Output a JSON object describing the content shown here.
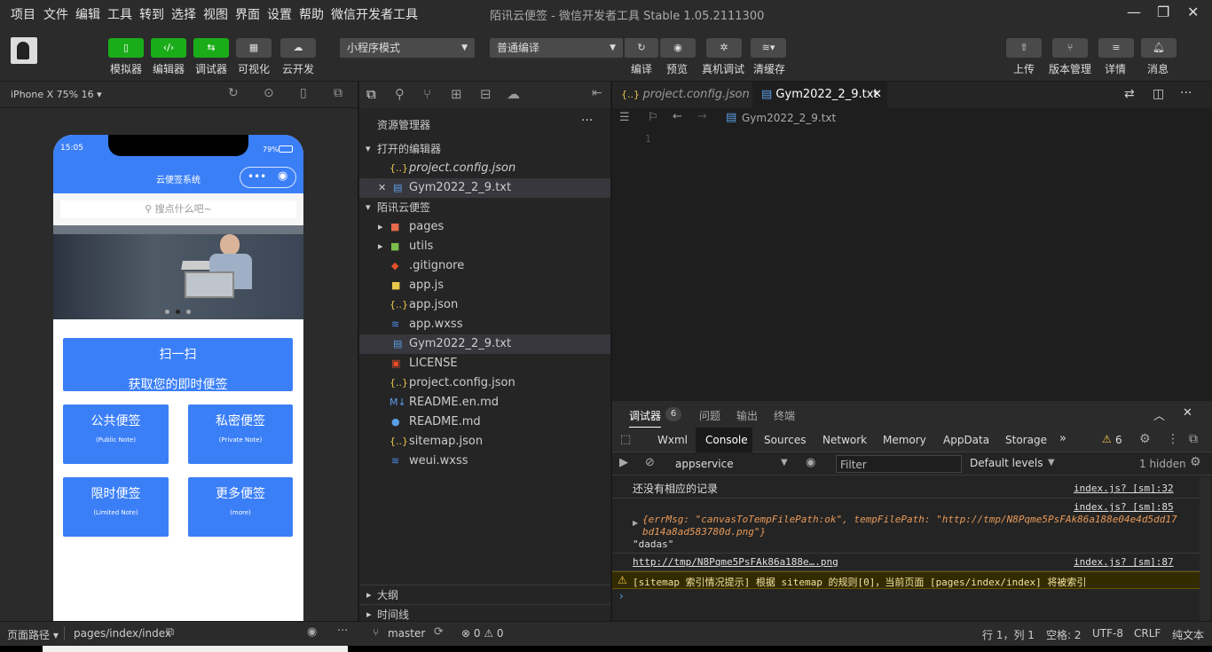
{
  "menu": [
    "项目",
    "文件",
    "编辑",
    "工具",
    "转到",
    "选择",
    "视图",
    "界面",
    "设置",
    "帮助",
    "微信开发者工具"
  ],
  "window_title": "陌讯云便签 - 微信开发者工具 Stable 1.05.2111300",
  "toolbar": {
    "simulator": "模拟器",
    "editor": "编辑器",
    "debugger": "调试器",
    "visual": "可视化",
    "cloud": "云开发",
    "mode_select": "小程序模式",
    "compile_select": "普通编译",
    "compile": "编译",
    "preview": "预览",
    "real_debug": "真机调试",
    "clear_cache": "清缓存",
    "upload": "上传",
    "version": "版本管理",
    "details": "详情",
    "messages": "消息"
  },
  "simulator": {
    "device": "iPhone X 75% 16 ▾",
    "time": "15:05",
    "battery": "79%",
    "nav_title": "云便签系统",
    "search_placeholder": "搜点什么吧~",
    "scan_title": "扫一扫",
    "scan_sub": "获取您的即时便签",
    "public_title": "公共便签",
    "public_sub": "(Public Note)",
    "private_title": "私密便签",
    "private_sub": "(Private Note)",
    "limited_title": "限时便签",
    "limited_sub": "(Limited Note)",
    "more_title": "更多便签",
    "more_sub": "(more)"
  },
  "explorer": {
    "title": "资源管理器",
    "open_editors": "打开的编辑器",
    "open_files": [
      "project.config.json",
      "Gym2022_2_9.txt"
    ],
    "project": "陌讯云便签",
    "files": [
      {
        "name": "pages",
        "icon": "▸"
      },
      {
        "name": "utils",
        "icon": "▸"
      },
      {
        "name": ".gitignore"
      },
      {
        "name": "app.js"
      },
      {
        "name": "app.json"
      },
      {
        "name": "app.wxss"
      },
      {
        "name": "Gym2022_2_9.txt"
      },
      {
        "name": "LICENSE"
      },
      {
        "name": "project.config.json"
      },
      {
        "name": "README.en.md"
      },
      {
        "name": "README.md"
      },
      {
        "name": "sitemap.json"
      },
      {
        "name": "weui.wxss"
      }
    ],
    "outline": "大纲",
    "timeline": "时间线"
  },
  "editor": {
    "tab1": "project.config.json",
    "tab2": "Gym2022_2_9.txt",
    "breadcrumb": "Gym2022_2_9.txt",
    "line_no": "1"
  },
  "console": {
    "tab_debugger": "调试器",
    "badge": "6",
    "tab_issues": "问题",
    "tab_output": "输出",
    "tab_terminal": "终端",
    "devtabs": [
      "Wxml",
      "Console",
      "Sources",
      "Network",
      "Memory",
      "AppData",
      "Storage"
    ],
    "warn_count": "6",
    "context": "appservice",
    "filter_placeholder": "Filter",
    "levels": "Default levels",
    "hidden": "1 hidden",
    "line1": "还没有相应的记录",
    "line1_src": "index.js? [sm]:32",
    "line2_src": "index.js? [sm]:85",
    "line2_a": "{errMsg: \"canvasToTempFilePath:ok\", tempFilePath: \"http://tmp/N8Pqme5PsFAk86a188e04e4d5dd17",
    "line2_b": "bd14a8ad583780d.png\"}",
    "line2_c": "\"dadas\"",
    "line3": "http://tmp/N8Pqme5PsFAk86a188e….png",
    "line3_src": "index.js? [sm]:87",
    "line4": "[sitemap 索引情况提示] 根据 sitemap 的规则[0]，当前页面 [pages/index/index] 将被索引"
  },
  "statusbar": {
    "page_path_label": "页面路径 ▾",
    "page_path": "pages/index/index",
    "branch": "master",
    "problems": "⊗ 0 ⚠ 0",
    "position": "行 1，列 1",
    "spaces": "空格: 2",
    "encoding": "UTF-8",
    "eol": "CRLF",
    "lang": "纯文本"
  }
}
